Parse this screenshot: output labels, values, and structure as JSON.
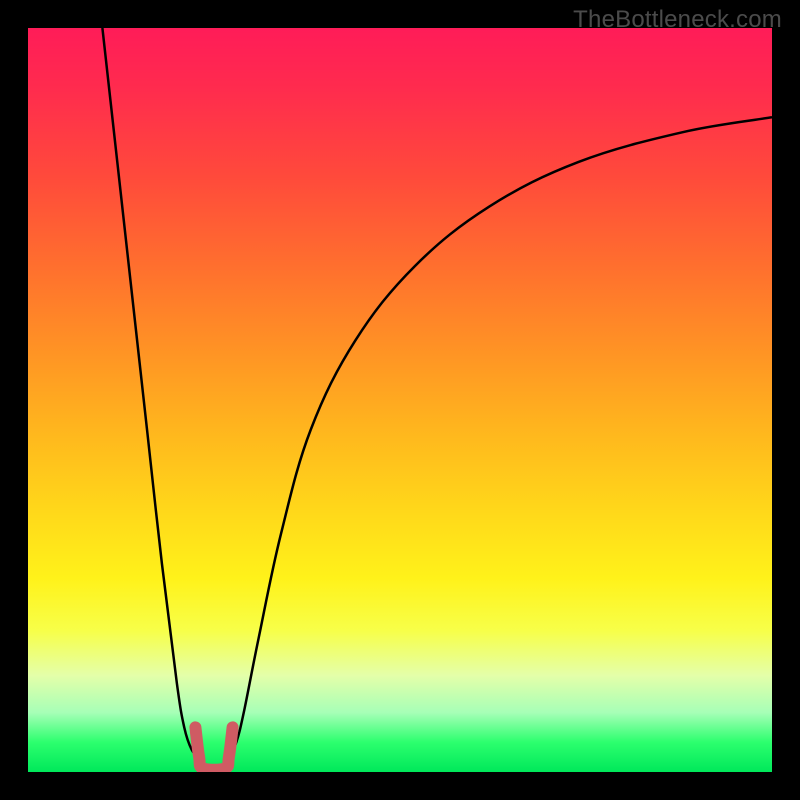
{
  "watermark": {
    "text": "TheBottleneck.com"
  },
  "chart_data": {
    "type": "line",
    "title": "",
    "xlabel": "",
    "ylabel": "",
    "xlim": [
      0,
      100
    ],
    "ylim": [
      0,
      100
    ],
    "background_gradient": {
      "direction": "vertical",
      "stops": [
        {
          "pos": 0,
          "color": "#ff1c58"
        },
        {
          "pos": 20,
          "color": "#ff4a3b"
        },
        {
          "pos": 44,
          "color": "#ff9524"
        },
        {
          "pos": 65,
          "color": "#ffd81a"
        },
        {
          "pos": 81,
          "color": "#f7ff49"
        },
        {
          "pos": 92,
          "color": "#a7ffb7"
        },
        {
          "pos": 100,
          "color": "#00e85a"
        }
      ]
    },
    "series": [
      {
        "name": "left-branch",
        "stroke": "#000000",
        "stroke_width": 2.5,
        "x": [
          10,
          12,
          14,
          16,
          18,
          20,
          21,
          22,
          23
        ],
        "y": [
          100,
          82,
          64,
          46,
          28,
          12,
          6,
          3,
          2
        ]
      },
      {
        "name": "right-branch",
        "stroke": "#000000",
        "stroke_width": 2.5,
        "x": [
          27,
          28,
          29,
          31,
          34,
          38,
          44,
          52,
          62,
          74,
          88,
          100
        ],
        "y": [
          2,
          4,
          8,
          18,
          32,
          46,
          58,
          68,
          76,
          82,
          86,
          88
        ]
      },
      {
        "name": "notch",
        "stroke": "#cf5b63",
        "stroke_width": 12,
        "linecap": "round",
        "x": [
          22.5,
          23,
          23.5,
          26.5,
          27,
          27.5
        ],
        "y": [
          6,
          2,
          0.5,
          0.5,
          2,
          6
        ]
      }
    ],
    "notch_center_x": 25,
    "notch_floor_y": 0.5
  }
}
